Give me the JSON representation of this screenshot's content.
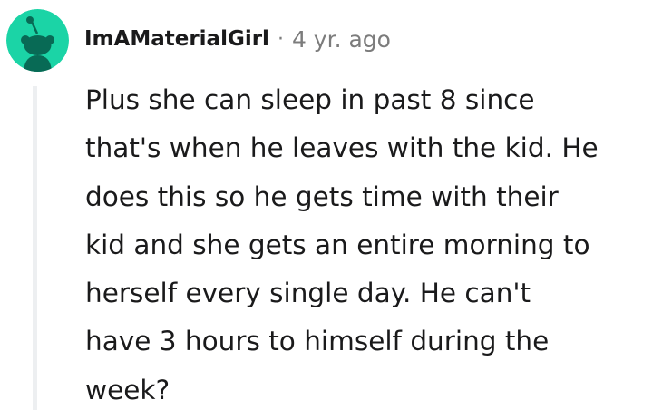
{
  "comment": {
    "author": "ImAMaterialGirl",
    "separator": "·",
    "timestamp": "4 yr. ago",
    "avatar_icon": "reddit-snoo-avatar-icon",
    "colors": {
      "avatar_bg": "#1bd4a6",
      "snoo_fill": "#086a55",
      "meta_gray": "#7c7c7c",
      "text": "#1a1a1b",
      "thread_line": "#edeff1"
    },
    "body_lines": [
      "Plus she can sleep in past 8 since",
      "that's when he leaves with the kid. He",
      "does this so he gets time with their",
      "kid and she gets an entire morning to",
      "herself every single day. He can't",
      "have 3 hours to himself during the",
      "week?"
    ]
  }
}
